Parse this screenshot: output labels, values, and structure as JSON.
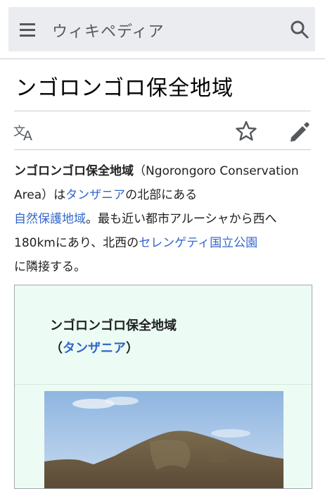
{
  "header": {
    "site_title": "ウィキペディア",
    "menu_icon": "hamburger-menu-icon",
    "search_icon": "search-icon"
  },
  "page": {
    "title": "ンゴロンゴロ保全地域"
  },
  "actions": {
    "language_icon": "language-icon",
    "watch_icon": "star-icon",
    "edit_icon": "edit-pencil-icon"
  },
  "intro": {
    "bold_name": "ンゴロンゴロ保全地域",
    "paren_open": "（Ngorongoro Conservation Area）は",
    "link_tanzania": "タンザニア",
    "text_2": "の北部にある",
    "link_conservation": "自然保護地域",
    "text_3": "。最も近い都市アルーシャから西へ180kmにあり、北西の",
    "link_serengeti": "セレンゲティ国立公園",
    "text_4": "に隣接する。"
  },
  "infobox": {
    "title": "ンゴロンゴロ保全地域",
    "paren_open": "（",
    "country_link": "タンザニア",
    "paren_close": "）",
    "image_desc": "mountain-photo",
    "background": "#ecfcf4"
  },
  "colors": {
    "link": "#3366cc",
    "text": "#202122",
    "header_bg": "#eaecf0"
  }
}
